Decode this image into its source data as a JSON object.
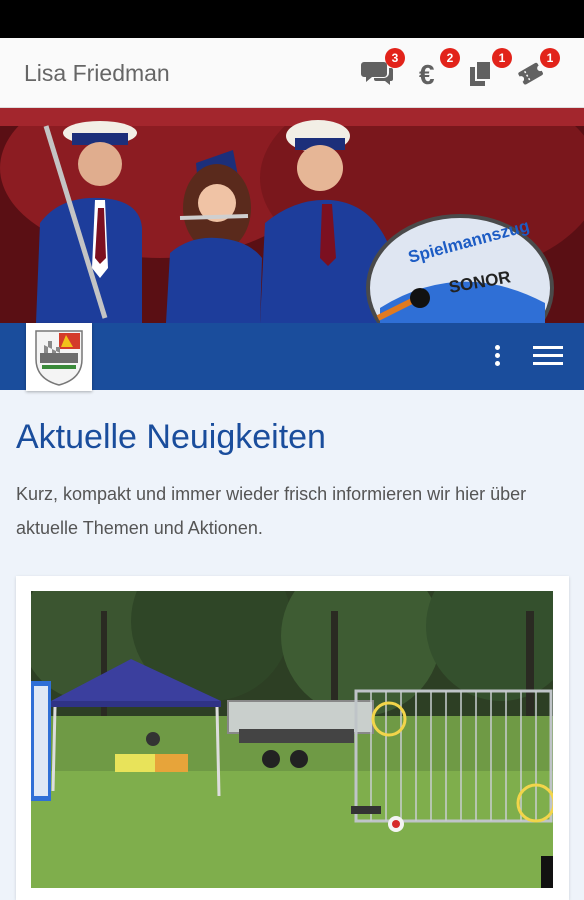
{
  "header": {
    "user_name": "Lisa Friedman",
    "icons": [
      {
        "name": "messages-icon",
        "badge": "3"
      },
      {
        "name": "euro-icon",
        "badge": "2"
      },
      {
        "name": "documents-icon",
        "badge": "1"
      },
      {
        "name": "tickets-icon",
        "badge": "1"
      }
    ],
    "badge_color": "#e2231a"
  },
  "hero": {
    "drum_text_1": "Spielmannszug",
    "drum_text_2": "SONOR"
  },
  "nav": {
    "color": "#1a4d9c",
    "menu_icons": [
      "more-vert-icon",
      "hamburger-menu-icon"
    ]
  },
  "main": {
    "title": "Aktuelle Neuigkeiten",
    "intro": "Kurz, kompakt und immer wieder frisch informieren wir hier über aktuelle Themen und Aktionen."
  }
}
